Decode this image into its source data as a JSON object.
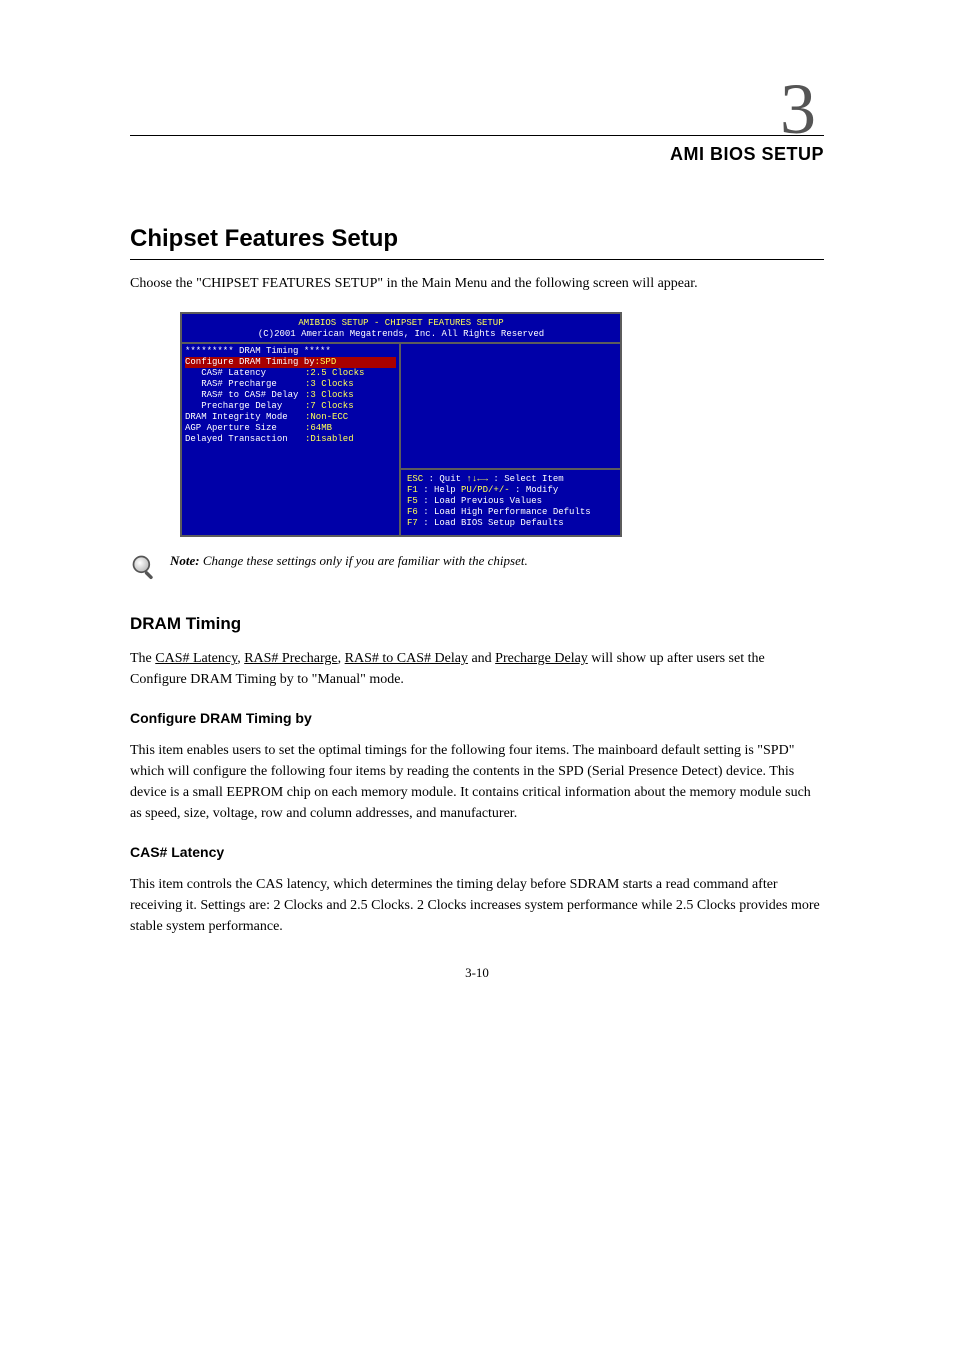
{
  "chapter": {
    "number": "3",
    "title": "AMI BIOS SETUP"
  },
  "section": {
    "heading": "Chipset Features Setup",
    "intro": "Choose the \"CHIPSET FEATURES SETUP\" in the Main Menu and the following screen will appear."
  },
  "bios": {
    "title_line1": "AMIBIOS SETUP - CHIPSET FEATURES SETUP",
    "title_line2": "(C)2001 American Megatrends, Inc. All Rights Reserved",
    "dram_header": "********* DRAM Timing *****",
    "items": [
      {
        "label": "Configure DRAM Timing by",
        "value": ":SPD",
        "highlight": true
      },
      {
        "label": "   CAS# Latency",
        "value": ":2.5 Clocks"
      },
      {
        "label": "   RAS# Precharge",
        "value": ":3 Clocks"
      },
      {
        "label": "   RAS# to CAS# Delay",
        "value": ":3 Clocks"
      },
      {
        "label": "   Precharge Delay",
        "value": ":7 Clocks"
      },
      {
        "label": "DRAM Integrity Mode",
        "value": ":Non-ECC"
      },
      {
        "label": "AGP Aperture Size",
        "value": ":64MB"
      },
      {
        "label": "Delayed Transaction",
        "value": ":Disabled"
      }
    ],
    "help": {
      "l1a": "ESC",
      "l1b": " : Quit        ",
      "l1c": "↑↓←→",
      "l1d": " : Select Item",
      "l2a": "F1",
      "l2b": "  : Help        ",
      "l2c": "PU/PD/+/-",
      "l2d": " : Modify",
      "l3a": "F5",
      "l3b": "  : Load Previous Values",
      "l4a": "F6",
      "l4b": "  : Load High Performance Defults",
      "l5a": "F7",
      "l5b": "  : Load BIOS Setup Defaults"
    }
  },
  "note": "Change these settings only if you are familiar with the chipset.",
  "dram": {
    "heading": "DRAM Timing",
    "desc_before": "The ",
    "desc_links": {
      "a": "CAS# Latency",
      "b": "RAS# Precharge",
      "c": "RAS# to CAS# Delay",
      "d_and": " and ",
      "d": "Precharge Delay"
    },
    "desc_after": " will show up after users set the Configure DRAM Timing by to \"Manual\" mode.",
    "cfg_title": "Configure DRAM Timing by",
    "cfg_desc": "This item enables users to set the optimal timings for the following four items. The mainboard default setting is \"SPD\" which will configure the following four items by reading the contents in the SPD (Serial Presence Detect) device. This device is a small EEPROM chip on each memory module. It contains critical information about the memory module such as speed, size, voltage, row and column addresses, and manufacturer.",
    "cas_title": "CAS# Latency",
    "cas_desc": "This item controls the CAS latency, which determines the timing delay before SDRAM starts a read command after receiving it. Settings are: 2 Clocks and 2.5 Clocks. 2 Clocks increases system performance while 2.5 Clocks provides more stable system performance."
  },
  "footer": "3-10"
}
